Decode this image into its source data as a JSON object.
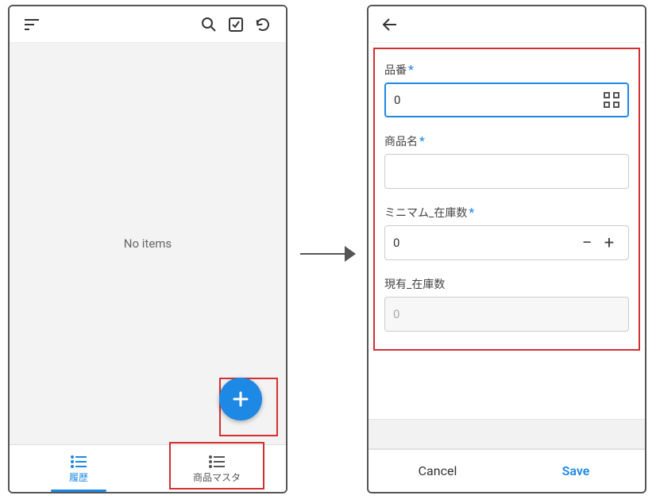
{
  "left": {
    "empty_text": "No items",
    "tabs": [
      {
        "label": "履歴",
        "active": true
      },
      {
        "label": "商品マスタ",
        "active": false
      }
    ]
  },
  "right": {
    "fields": {
      "code": {
        "label": "品番",
        "value": "0",
        "required": true
      },
      "name": {
        "label": "商品名",
        "value": "",
        "required": true
      },
      "min": {
        "label": "ミニマム_在庫数",
        "value": "0",
        "required": true
      },
      "stock": {
        "label": "現有_在庫数",
        "value": "0",
        "required": false
      }
    },
    "actions": {
      "cancel": "Cancel",
      "save": "Save"
    }
  }
}
